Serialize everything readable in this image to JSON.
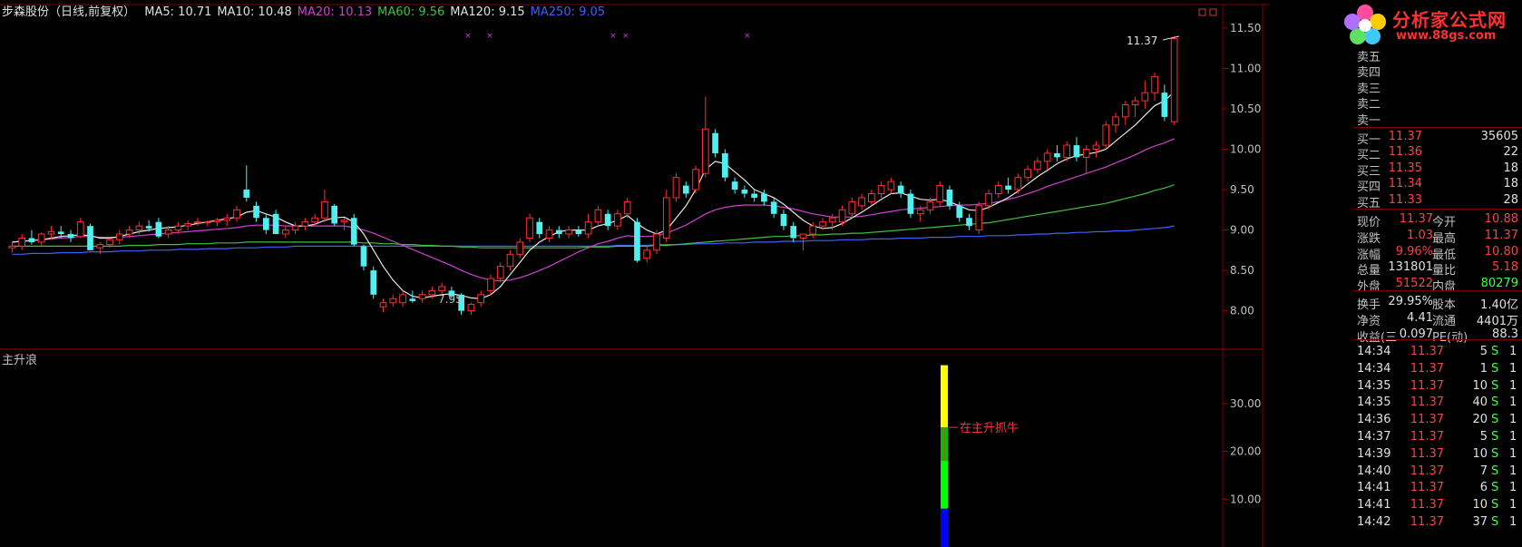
{
  "header": {
    "title": "步森股份（日线,前复权）",
    "ma": [
      {
        "label": "MA5: 10.71",
        "color": "#e0e0e0"
      },
      {
        "label": "MA10: 10.48",
        "color": "#e0e0e0"
      },
      {
        "label": "MA20: 10.13",
        "color": "#d040d0"
      },
      {
        "label": "MA60: 9.56",
        "color": "#40c040"
      },
      {
        "label": "MA120: 9.15",
        "color": "#e0e0e0"
      },
      {
        "label": "MA250: 9.05",
        "color": "#4060ff"
      }
    ]
  },
  "indicator": {
    "title": "主升浪",
    "annotation": "在主升抓牛"
  },
  "logo": {
    "name": "分析家公式网",
    "url": "www.88gs.com"
  },
  "price_axis": [
    "11.50",
    "11.00",
    "10.50",
    "10.00",
    "9.50",
    "9.00",
    "8.50",
    "8.00"
  ],
  "indicator_axis": [
    "30.00",
    "20.00",
    "10.00"
  ],
  "markers": {
    "high": "11.37",
    "low": "7.95"
  },
  "colors": {
    "up": "#ff3030",
    "down": "#50f0f0",
    "background": "#000000",
    "grid": "#800000"
  },
  "chart_data": {
    "type": "candlestick",
    "ylim": [
      7.85,
      11.6
    ],
    "candles": [
      [
        8.78,
        8.85,
        8.72,
        8.8
      ],
      [
        8.8,
        8.95,
        8.75,
        8.9
      ],
      [
        8.9,
        9.0,
        8.82,
        8.85
      ],
      [
        8.85,
        8.97,
        8.8,
        8.95
      ],
      [
        8.95,
        9.05,
        8.88,
        8.98
      ],
      [
        8.98,
        9.05,
        8.9,
        8.95
      ],
      [
        8.95,
        9.0,
        8.85,
        8.9
      ],
      [
        8.92,
        9.15,
        8.9,
        9.1
      ],
      [
        9.05,
        9.08,
        8.75,
        8.75
      ],
      [
        8.78,
        8.85,
        8.7,
        8.82
      ],
      [
        8.82,
        8.9,
        8.78,
        8.88
      ],
      [
        8.88,
        9.0,
        8.82,
        8.95
      ],
      [
        8.95,
        9.05,
        8.9,
        9.0
      ],
      [
        9.0,
        9.1,
        8.95,
        9.05
      ],
      [
        9.05,
        9.12,
        8.98,
        9.02
      ],
      [
        9.1,
        9.15,
        8.9,
        8.92
      ],
      [
        8.95,
        9.05,
        8.9,
        9.0
      ],
      [
        9.0,
        9.1,
        8.95,
        9.05
      ],
      [
        9.05,
        9.12,
        9.0,
        9.08
      ],
      [
        9.1,
        9.15,
        9.05,
        9.1
      ],
      [
        9.1,
        9.12,
        9.05,
        9.1
      ],
      [
        9.1,
        9.15,
        9.05,
        9.12
      ],
      [
        9.12,
        9.2,
        9.05,
        9.15
      ],
      [
        9.15,
        9.3,
        9.1,
        9.25
      ],
      [
        9.5,
        9.8,
        9.35,
        9.4
      ],
      [
        9.3,
        9.35,
        9.1,
        9.15
      ],
      [
        9.15,
        9.2,
        8.95,
        9.0
      ],
      [
        9.2,
        9.25,
        8.95,
        8.95
      ],
      [
        8.95,
        9.05,
        8.9,
        9.0
      ],
      [
        9.0,
        9.1,
        8.95,
        9.05
      ],
      [
        9.05,
        9.15,
        9.0,
        9.1
      ],
      [
        9.1,
        9.2,
        9.05,
        9.15
      ],
      [
        9.15,
        9.5,
        9.1,
        9.35
      ],
      [
        9.3,
        9.32,
        9.05,
        9.08
      ],
      [
        9.1,
        9.15,
        9.0,
        9.12
      ],
      [
        9.15,
        9.2,
        8.8,
        8.82
      ],
      [
        8.8,
        8.82,
        8.5,
        8.55
      ],
      [
        8.5,
        8.55,
        8.15,
        8.2
      ],
      [
        8.05,
        8.15,
        7.98,
        8.1
      ],
      [
        8.1,
        8.2,
        8.05,
        8.15
      ],
      [
        8.1,
        8.25,
        8.05,
        8.2
      ],
      [
        8.15,
        8.25,
        8.1,
        8.12
      ],
      [
        8.15,
        8.25,
        8.1,
        8.2
      ],
      [
        8.2,
        8.3,
        8.15,
        8.25
      ],
      [
        8.25,
        8.35,
        8.2,
        8.3
      ],
      [
        8.25,
        8.3,
        8.15,
        8.18
      ],
      [
        8.2,
        8.22,
        7.95,
        8.0
      ],
      [
        8.0,
        8.1,
        7.95,
        8.08
      ],
      [
        8.1,
        8.25,
        8.05,
        8.2
      ],
      [
        8.25,
        8.45,
        8.2,
        8.4
      ],
      [
        8.4,
        8.6,
        8.35,
        8.55
      ],
      [
        8.55,
        8.75,
        8.5,
        8.7
      ],
      [
        8.7,
        8.9,
        8.65,
        8.85
      ],
      [
        8.9,
        9.2,
        8.85,
        9.15
      ],
      [
        9.1,
        9.15,
        8.9,
        8.95
      ],
      [
        8.9,
        9.05,
        8.85,
        9.0
      ],
      [
        9.0,
        9.05,
        8.9,
        8.95
      ],
      [
        8.95,
        9.05,
        8.9,
        9.0
      ],
      [
        9.0,
        9.05,
        8.92,
        8.95
      ],
      [
        8.95,
        9.2,
        8.9,
        9.1
      ],
      [
        9.1,
        9.3,
        9.05,
        9.25
      ],
      [
        9.2,
        9.25,
        9.0,
        9.05
      ],
      [
        9.05,
        9.25,
        9.0,
        9.2
      ],
      [
        9.2,
        9.4,
        9.15,
        9.35
      ],
      [
        9.1,
        9.15,
        8.6,
        8.62
      ],
      [
        8.65,
        8.8,
        8.6,
        8.75
      ],
      [
        8.75,
        9.0,
        8.7,
        8.95
      ],
      [
        8.9,
        9.5,
        8.85,
        9.4
      ],
      [
        9.4,
        9.7,
        9.35,
        9.65
      ],
      [
        9.55,
        9.6,
        9.4,
        9.45
      ],
      [
        9.5,
        9.8,
        9.45,
        9.75
      ],
      [
        9.7,
        10.65,
        9.65,
        10.25
      ],
      [
        10.2,
        10.25,
        9.9,
        9.95
      ],
      [
        9.95,
        10.0,
        9.6,
        9.65
      ],
      [
        9.6,
        9.65,
        9.45,
        9.5
      ],
      [
        9.5,
        9.55,
        9.4,
        9.45
      ],
      [
        9.45,
        9.5,
        9.35,
        9.4
      ],
      [
        9.45,
        9.5,
        9.3,
        9.35
      ],
      [
        9.35,
        9.4,
        9.15,
        9.2
      ],
      [
        9.2,
        9.25,
        9.0,
        9.05
      ],
      [
        9.05,
        9.1,
        8.85,
        8.9
      ],
      [
        8.9,
        8.95,
        8.75,
        8.95
      ],
      [
        8.95,
        9.1,
        8.9,
        9.05
      ],
      [
        9.05,
        9.15,
        9.0,
        9.1
      ],
      [
        9.1,
        9.2,
        9.0,
        9.15
      ],
      [
        9.1,
        9.3,
        9.05,
        9.25
      ],
      [
        9.2,
        9.4,
        9.15,
        9.35
      ],
      [
        9.3,
        9.45,
        9.25,
        9.4
      ],
      [
        9.35,
        9.5,
        9.3,
        9.45
      ],
      [
        9.45,
        9.6,
        9.4,
        9.55
      ],
      [
        9.5,
        9.65,
        9.45,
        9.6
      ],
      [
        9.55,
        9.6,
        9.4,
        9.45
      ],
      [
        9.45,
        9.5,
        9.15,
        9.2
      ],
      [
        9.2,
        9.3,
        9.1,
        9.25
      ],
      [
        9.25,
        9.4,
        9.2,
        9.35
      ],
      [
        9.35,
        9.6,
        9.3,
        9.55
      ],
      [
        9.5,
        9.55,
        9.25,
        9.3
      ],
      [
        9.3,
        9.35,
        9.1,
        9.15
      ],
      [
        9.15,
        9.2,
        9.0,
        9.05
      ],
      [
        9.0,
        9.35,
        8.95,
        9.3
      ],
      [
        9.3,
        9.5,
        9.25,
        9.45
      ],
      [
        9.45,
        9.6,
        9.4,
        9.55
      ],
      [
        9.55,
        9.65,
        9.45,
        9.5
      ],
      [
        9.5,
        9.7,
        9.45,
        9.65
      ],
      [
        9.65,
        9.8,
        9.6,
        9.75
      ],
      [
        9.75,
        9.9,
        9.7,
        9.85
      ],
      [
        9.85,
        10.0,
        9.75,
        9.95
      ],
      [
        9.95,
        10.05,
        9.85,
        9.9
      ],
      [
        9.9,
        10.1,
        9.85,
        10.05
      ],
      [
        10.05,
        10.15,
        9.85,
        9.9
      ],
      [
        9.9,
        10.05,
        9.7,
        10.0
      ],
      [
        10.0,
        10.1,
        9.9,
        10.05
      ],
      [
        10.05,
        10.35,
        10.0,
        10.3
      ],
      [
        10.3,
        10.45,
        10.2,
        10.4
      ],
      [
        10.4,
        10.6,
        10.3,
        10.55
      ],
      [
        10.55,
        10.65,
        10.4,
        10.6
      ],
      [
        10.6,
        10.85,
        10.5,
        10.7
      ],
      [
        10.7,
        10.95,
        10.6,
        10.9
      ],
      [
        10.7,
        10.8,
        10.35,
        10.4
      ],
      [
        10.34,
        11.4,
        10.3,
        11.37
      ]
    ],
    "ma5": [
      8.85,
      8.86,
      8.87,
      8.88,
      8.9,
      8.92,
      8.93,
      8.94,
      8.93,
      8.9,
      8.9,
      8.92,
      8.95,
      8.98,
      9.0,
      9.02,
      9.03,
      9.04,
      9.06,
      9.08,
      9.1,
      9.12,
      9.14,
      9.16,
      9.22,
      9.24,
      9.2,
      9.16,
      9.1,
      9.05,
      9.05,
      9.07,
      9.12,
      9.15,
      9.16,
      9.1,
      8.95,
      8.75,
      8.55,
      8.38,
      8.25,
      8.18,
      8.16,
      8.18,
      8.2,
      8.21,
      8.19,
      8.16,
      8.15,
      8.2,
      8.3,
      8.45,
      8.6,
      8.75,
      8.85,
      8.92,
      8.98,
      9.0,
      9.0,
      9.0,
      9.05,
      9.08,
      9.12,
      9.18,
      9.08,
      9.0,
      8.95,
      9.0,
      9.15,
      9.3,
      9.5,
      9.75,
      9.85,
      9.82,
      9.72,
      9.62,
      9.5,
      9.45,
      9.4,
      9.32,
      9.22,
      9.12,
      9.05,
      9.02,
      9.03,
      9.08,
      9.15,
      9.22,
      9.3,
      9.38,
      9.45,
      9.46,
      9.42,
      9.38,
      9.37,
      9.38,
      9.35,
      9.3,
      9.25,
      9.24,
      9.28,
      9.34,
      9.4,
      9.48,
      9.57,
      9.66,
      9.74,
      9.82,
      9.88,
      9.92,
      9.94,
      9.96,
      10.0,
      10.1,
      10.2,
      10.3,
      10.42,
      10.54,
      10.6,
      10.71
    ],
    "ma20": [
      8.85,
      8.86,
      8.87,
      8.88,
      8.89,
      8.9,
      8.91,
      8.92,
      8.92,
      8.91,
      8.91,
      8.91,
      8.92,
      8.93,
      8.94,
      8.95,
      8.96,
      8.97,
      8.98,
      8.99,
      9.0,
      9.01,
      9.02,
      9.03,
      9.05,
      9.06,
      9.06,
      9.06,
      9.05,
      9.05,
      9.05,
      9.05,
      9.05,
      9.05,
      9.05,
      9.03,
      9.0,
      8.96,
      8.91,
      8.86,
      8.81,
      8.76,
      8.71,
      8.66,
      8.61,
      8.56,
      8.5,
      8.45,
      8.41,
      8.38,
      8.37,
      8.38,
      8.41,
      8.45,
      8.5,
      8.55,
      8.61,
      8.67,
      8.73,
      8.78,
      8.83,
      8.86,
      8.9,
      8.93,
      8.92,
      8.92,
      8.93,
      8.96,
      9.01,
      9.06,
      9.13,
      9.2,
      9.25,
      9.28,
      9.3,
      9.31,
      9.31,
      9.31,
      9.3,
      9.28,
      9.26,
      9.23,
      9.2,
      9.18,
      9.16,
      9.16,
      9.16,
      9.17,
      9.19,
      9.21,
      9.23,
      9.25,
      9.26,
      9.27,
      9.28,
      9.29,
      9.3,
      9.31,
      9.31,
      9.32,
      9.33,
      9.35,
      9.38,
      9.41,
      9.45,
      9.49,
      9.54,
      9.58,
      9.62,
      9.66,
      9.7,
      9.74,
      9.78,
      9.83,
      9.88,
      9.93,
      9.99,
      10.04,
      10.08,
      10.13
    ],
    "ma60": [
      8.8,
      8.8,
      8.8,
      8.8,
      8.8,
      8.8,
      8.8,
      8.8,
      8.8,
      8.8,
      8.8,
      8.8,
      8.81,
      8.81,
      8.81,
      8.82,
      8.82,
      8.82,
      8.83,
      8.83,
      8.83,
      8.84,
      8.84,
      8.84,
      8.85,
      8.85,
      8.85,
      8.85,
      8.85,
      8.85,
      8.85,
      8.85,
      8.85,
      8.85,
      8.85,
      8.85,
      8.84,
      8.84,
      8.83,
      8.83,
      8.82,
      8.82,
      8.81,
      8.81,
      8.8,
      8.8,
      8.79,
      8.79,
      8.78,
      8.78,
      8.78,
      8.78,
      8.78,
      8.78,
      8.78,
      8.78,
      8.78,
      8.78,
      8.78,
      8.79,
      8.79,
      8.79,
      8.8,
      8.8,
      8.8,
      8.8,
      8.81,
      8.81,
      8.82,
      8.83,
      8.84,
      8.85,
      8.86,
      8.87,
      8.88,
      8.89,
      8.9,
      8.91,
      8.92,
      8.92,
      8.93,
      8.93,
      8.94,
      8.94,
      8.95,
      8.95,
      8.96,
      8.96,
      8.97,
      8.98,
      8.99,
      9.0,
      9.01,
      9.02,
      9.03,
      9.04,
      9.05,
      9.06,
      9.07,
      9.08,
      9.09,
      9.11,
      9.13,
      9.15,
      9.17,
      9.19,
      9.21,
      9.23,
      9.25,
      9.27,
      9.29,
      9.31,
      9.33,
      9.36,
      9.39,
      9.42,
      9.45,
      9.49,
      9.52,
      9.56
    ],
    "ma250": [
      8.7,
      8.7,
      8.71,
      8.71,
      8.71,
      8.72,
      8.72,
      8.72,
      8.73,
      8.73,
      8.73,
      8.74,
      8.74,
      8.74,
      8.75,
      8.75,
      8.75,
      8.76,
      8.76,
      8.76,
      8.77,
      8.77,
      8.77,
      8.78,
      8.78,
      8.78,
      8.79,
      8.79,
      8.79,
      8.8,
      8.8,
      8.8,
      8.8,
      8.8,
      8.8,
      8.8,
      8.8,
      8.8,
      8.8,
      8.8,
      8.8,
      8.8,
      8.8,
      8.8,
      8.8,
      8.8,
      8.8,
      8.8,
      8.8,
      8.8,
      8.8,
      8.8,
      8.8,
      8.8,
      8.8,
      8.8,
      8.8,
      8.8,
      8.8,
      8.8,
      8.8,
      8.8,
      8.81,
      8.81,
      8.81,
      8.81,
      8.82,
      8.82,
      8.82,
      8.82,
      8.83,
      8.83,
      8.83,
      8.84,
      8.84,
      8.84,
      8.85,
      8.85,
      8.85,
      8.86,
      8.86,
      8.86,
      8.87,
      8.87,
      8.87,
      8.88,
      8.88,
      8.88,
      8.89,
      8.89,
      8.89,
      8.9,
      8.9,
      8.9,
      8.91,
      8.91,
      8.91,
      8.92,
      8.92,
      8.92,
      8.93,
      8.93,
      8.93,
      8.94,
      8.94,
      8.95,
      8.95,
      8.96,
      8.96,
      8.97,
      8.97,
      8.98,
      8.98,
      8.99,
      8.99,
      9.0,
      9.01,
      9.02,
      9.03,
      9.05
    ],
    "indicator_bar": {
      "ylim": [
        0,
        40
      ],
      "segments": [
        {
          "from": 25,
          "to": 38,
          "color": "#ffff00"
        },
        {
          "from": 18,
          "to": 25,
          "color": "#00c000"
        },
        {
          "from": 8,
          "to": 18,
          "color": "#00ff00"
        },
        {
          "from": 0,
          "to": 8,
          "color": "#0000ff"
        }
      ]
    }
  },
  "panel": {
    "sell": [
      "卖五",
      "卖四",
      "卖三",
      "卖二",
      "卖一"
    ],
    "buy": [
      {
        "label": "买一",
        "price": "11.37",
        "vol": "35605"
      },
      {
        "label": "买二",
        "price": "11.36",
        "vol": "22"
      },
      {
        "label": "买三",
        "price": "11.35",
        "vol": "18"
      },
      {
        "label": "买四",
        "price": "11.34",
        "vol": "18"
      },
      {
        "label": "买五",
        "price": "11.33",
        "vol": "28"
      }
    ],
    "stats": [
      {
        "l1": "现价",
        "v1": "11.37",
        "c1": "red",
        "l2": "今开",
        "v2": "10.88",
        "c2": "red"
      },
      {
        "l1": "涨跌",
        "v1": "1.03",
        "c1": "red",
        "l2": "最高",
        "v2": "11.37",
        "c2": "red"
      },
      {
        "l1": "涨幅",
        "v1": "9.96%",
        "c1": "red",
        "l2": "最低",
        "v2": "10.80",
        "c2": "red"
      },
      {
        "l1": "总量",
        "v1": "131801",
        "c1": "white",
        "l2": "量比",
        "v2": "5.18",
        "c2": "red"
      },
      {
        "l1": "外盘",
        "v1": "51522",
        "c1": "red",
        "l2": "内盘",
        "v2": "80279",
        "c2": "green"
      },
      {
        "l1": "换手",
        "v1": "29.95%",
        "c1": "white",
        "l2": "股本",
        "v2": "1.40亿",
        "c2": "white"
      },
      {
        "l1": "净资",
        "v1": "4.41",
        "c1": "white",
        "l2": "流通",
        "v2": "4401万",
        "c2": "white"
      },
      {
        "l1": "收益(三",
        "v1": "0.097",
        "c1": "white",
        "l2": "PE(动)",
        "v2": "88.3",
        "c2": "white"
      }
    ],
    "ticks": [
      {
        "t": "14:34",
        "p": "11.37",
        "q": "5",
        "s": "S",
        "n": "1"
      },
      {
        "t": "14:34",
        "p": "11.37",
        "q": "1",
        "s": "S",
        "n": "1"
      },
      {
        "t": "14:35",
        "p": "11.37",
        "q": "10",
        "s": "S",
        "n": "1"
      },
      {
        "t": "14:35",
        "p": "11.37",
        "q": "40",
        "s": "S",
        "n": "1"
      },
      {
        "t": "14:36",
        "p": "11.37",
        "q": "20",
        "s": "S",
        "n": "1"
      },
      {
        "t": "14:37",
        "p": "11.37",
        "q": "5",
        "s": "S",
        "n": "1"
      },
      {
        "t": "14:39",
        "p": "11.37",
        "q": "10",
        "s": "S",
        "n": "1"
      },
      {
        "t": "14:40",
        "p": "11.37",
        "q": "7",
        "s": "S",
        "n": "1"
      },
      {
        "t": "14:41",
        "p": "11.37",
        "q": "6",
        "s": "S",
        "n": "1"
      },
      {
        "t": "14:41",
        "p": "11.37",
        "q": "10",
        "s": "S",
        "n": "1"
      },
      {
        "t": "14:42",
        "p": "11.37",
        "q": "37",
        "s": "S",
        "n": "1"
      }
    ]
  }
}
